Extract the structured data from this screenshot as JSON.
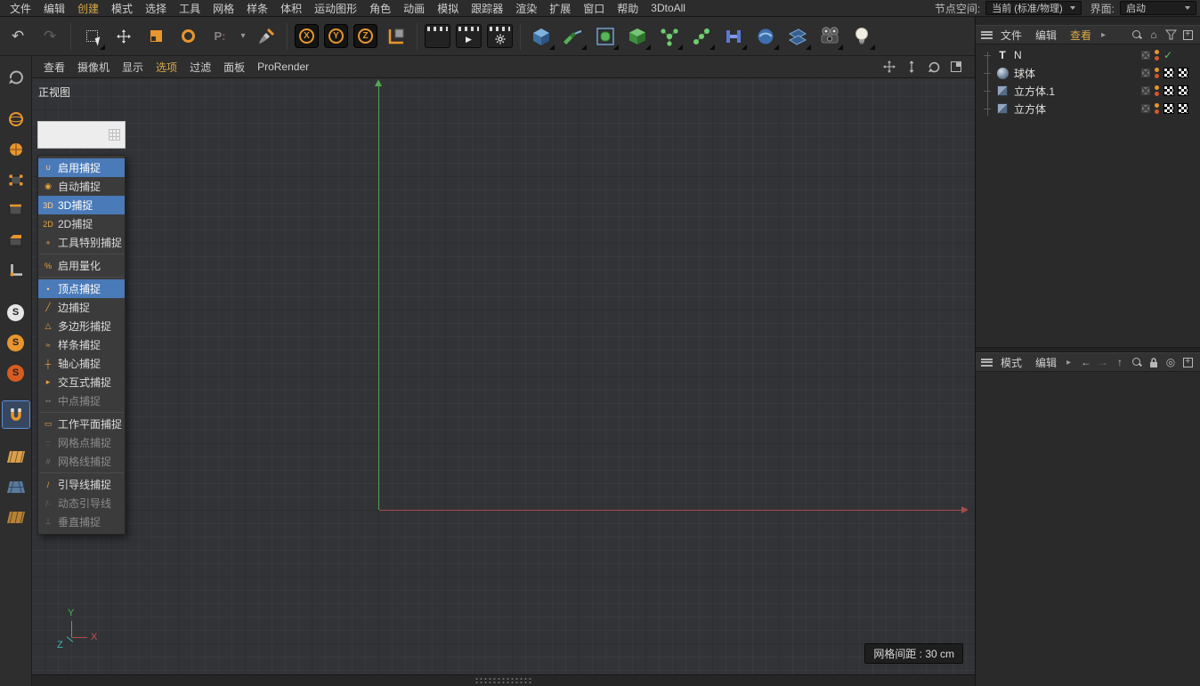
{
  "colors": {
    "accent_orange": "#e8962e",
    "selection_blue": "#4a7ab8",
    "menu_highlight": "#d8a948",
    "axis_green": "#55a555",
    "axis_red": "#a84a4a",
    "axis_z_teal": "#3fb5b5"
  },
  "glyphs": {
    "undo": "↶",
    "redo": "↷",
    "caret": "▾",
    "menu_arrow": "▸",
    "play": "▶",
    "home": "⌂",
    "target": "◎",
    "back": "←",
    "forward": "→",
    "up": "↑",
    "check": "✓",
    "text_tool": "T",
    "recent": "P",
    "solo": "S"
  },
  "menubar": {
    "items": [
      "文件",
      "编辑",
      "创建",
      "模式",
      "选择",
      "工具",
      "网格",
      "样条",
      "体积",
      "运动图形",
      "角色",
      "动画",
      "模拟",
      "跟踪器",
      "渲染",
      "扩展",
      "窗口",
      "帮助",
      "3DtoAll"
    ],
    "active_item": "创建",
    "node_space_label": "节点空间:",
    "node_space_value": "当前 (标准/物理)",
    "interface_label": "界面:",
    "interface_value": "启动"
  },
  "toolbar": {
    "axis_lock": [
      "X",
      "Y",
      "Z"
    ],
    "icons": [
      "undo",
      "redo",
      "live-selection",
      "move",
      "scale",
      "rotate",
      "recent-tool",
      "recent-tool-dropdown",
      "tweak-brush",
      "x-lock",
      "y-lock",
      "z-lock",
      "coordinate-system",
      "render-view",
      "render-picture-viewer",
      "render-settings",
      "primitive-cube",
      "spline-pen",
      "subdivision-surface",
      "generator",
      "array",
      "cloner",
      "spline-boolean",
      "field",
      "floor",
      "camera",
      "light"
    ]
  },
  "left_toolbar": {
    "icons": [
      "make-editable",
      "model-mode",
      "texture-mode",
      "points-mode",
      "edges-mode",
      "polygons-mode",
      "enable-axis",
      "viewport-solo-off",
      "viewport-solo-single",
      "viewport-solo-hierarchy",
      "enable-snap",
      "workplane",
      "planar-workplane",
      "workplane-lock"
    ],
    "active": "enable-snap"
  },
  "viewport": {
    "menus": [
      "查看",
      "摄像机",
      "显示",
      "选项",
      "过滤",
      "面板",
      "ProRender"
    ],
    "active_menu": "选项",
    "view_label": "正视图",
    "grid_badge": "网格间距 : 30 cm",
    "axis": {
      "x": "X",
      "y": "Y",
      "z": "Z"
    },
    "nav_icons": [
      "pan-view",
      "dolly-view",
      "rotate-view",
      "toggle-view"
    ]
  },
  "snap_palette": {
    "items": [
      {
        "label": "启用捕捉",
        "glyph": "∪",
        "selected": true,
        "disabled": false
      },
      {
        "label": "自动捕捉",
        "glyph": "◉",
        "selected": false,
        "disabled": false
      },
      {
        "label": "3D捕捉",
        "glyph": "3D",
        "selected": true,
        "disabled": false
      },
      {
        "label": "2D捕捉",
        "glyph": "2D",
        "selected": false,
        "disabled": false
      },
      {
        "label": "工具特别捕捉",
        "glyph": "+",
        "selected": false,
        "disabled": false
      },
      {
        "label": "启用量化",
        "glyph": "%",
        "selected": false,
        "disabled": false
      },
      {
        "label": "顶点捕捉",
        "glyph": "•",
        "selected": true,
        "disabled": false
      },
      {
        "label": "边捕捉",
        "glyph": "╱",
        "selected": false,
        "disabled": false
      },
      {
        "label": "多边形捕捉",
        "glyph": "△",
        "selected": false,
        "disabled": false
      },
      {
        "label": "样条捕捉",
        "glyph": "≈",
        "selected": false,
        "disabled": false
      },
      {
        "label": "轴心捕捉",
        "glyph": "┼",
        "selected": false,
        "disabled": false
      },
      {
        "label": "交互式捕捉",
        "glyph": "▸",
        "selected": false,
        "disabled": false
      },
      {
        "label": "中点捕捉",
        "glyph": "••",
        "selected": false,
        "disabled": true
      },
      {
        "label": "工作平面捕捉",
        "glyph": "▭",
        "selected": false,
        "disabled": false
      },
      {
        "label": "网格点捕捉",
        "glyph": "::",
        "selected": false,
        "disabled": true
      },
      {
        "label": "网格线捕捉",
        "glyph": "#",
        "selected": false,
        "disabled": true
      },
      {
        "label": "引导线捕捉",
        "glyph": "/",
        "selected": false,
        "disabled": false
      },
      {
        "label": "动态引导线",
        "glyph": "/·",
        "selected": false,
        "disabled": true
      },
      {
        "label": "垂直捕捉",
        "glyph": "⊥",
        "selected": false,
        "disabled": true
      }
    ]
  },
  "object_manager": {
    "menus": [
      "文件",
      "编辑",
      "查看"
    ],
    "objects": [
      {
        "name": "N",
        "type": "text-spline",
        "tags": [
          "enabled-check"
        ]
      },
      {
        "name": "球体",
        "type": "sphere",
        "tags": [
          "texture-tag",
          "texture-tag"
        ]
      },
      {
        "name": "立方体.1",
        "type": "cube",
        "tags": [
          "texture-tag",
          "texture-tag"
        ]
      },
      {
        "name": "立方体",
        "type": "cube",
        "tags": [
          "texture-tag",
          "texture-tag"
        ]
      }
    ]
  },
  "attribute_manager": {
    "menus": [
      "模式",
      "编辑"
    ]
  }
}
